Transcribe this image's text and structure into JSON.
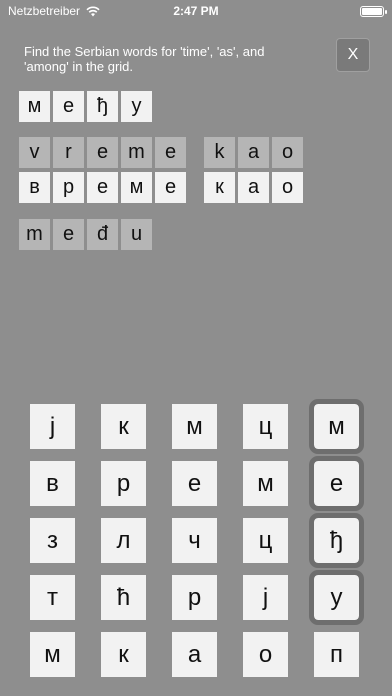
{
  "status_bar": {
    "carrier": "Netzbetreiber",
    "time": "2:47 PM",
    "battery_level": 1.0
  },
  "instructions": "Find the Serbian words for 'time', 'as', and 'among' in the grid.",
  "close_label": "X",
  "found_word": [
    "м",
    "е",
    "ђ",
    "у"
  ],
  "hint_latin_1": [
    "v",
    "r",
    "e",
    "m",
    "e"
  ],
  "hint_latin_2": [
    "k",
    "a",
    "o"
  ],
  "hint_cyrillic_1": [
    "в",
    "р",
    "е",
    "м",
    "е"
  ],
  "hint_cyrillic_2": [
    "к",
    "а",
    "о"
  ],
  "hint_latin_3": [
    "m",
    "e",
    "đ",
    "u"
  ],
  "grid": [
    [
      "ј",
      "к",
      "м",
      "ц",
      "м"
    ],
    [
      "в",
      "р",
      "е",
      "м",
      "е"
    ],
    [
      "з",
      "л",
      "ч",
      "ц",
      "ђ"
    ],
    [
      "т",
      "ћ",
      "р",
      "ј",
      "у"
    ],
    [
      "м",
      "к",
      "а",
      "о",
      "п"
    ]
  ],
  "selected_cells": [
    [
      0,
      4
    ],
    [
      1,
      4
    ],
    [
      2,
      4
    ],
    [
      3,
      4
    ]
  ],
  "colors": {
    "background": "#8e8e8e",
    "tile_light": "#f2f2f2",
    "tile_dim": "#b5b5b5",
    "selection_outline": "#6e6e6e"
  }
}
